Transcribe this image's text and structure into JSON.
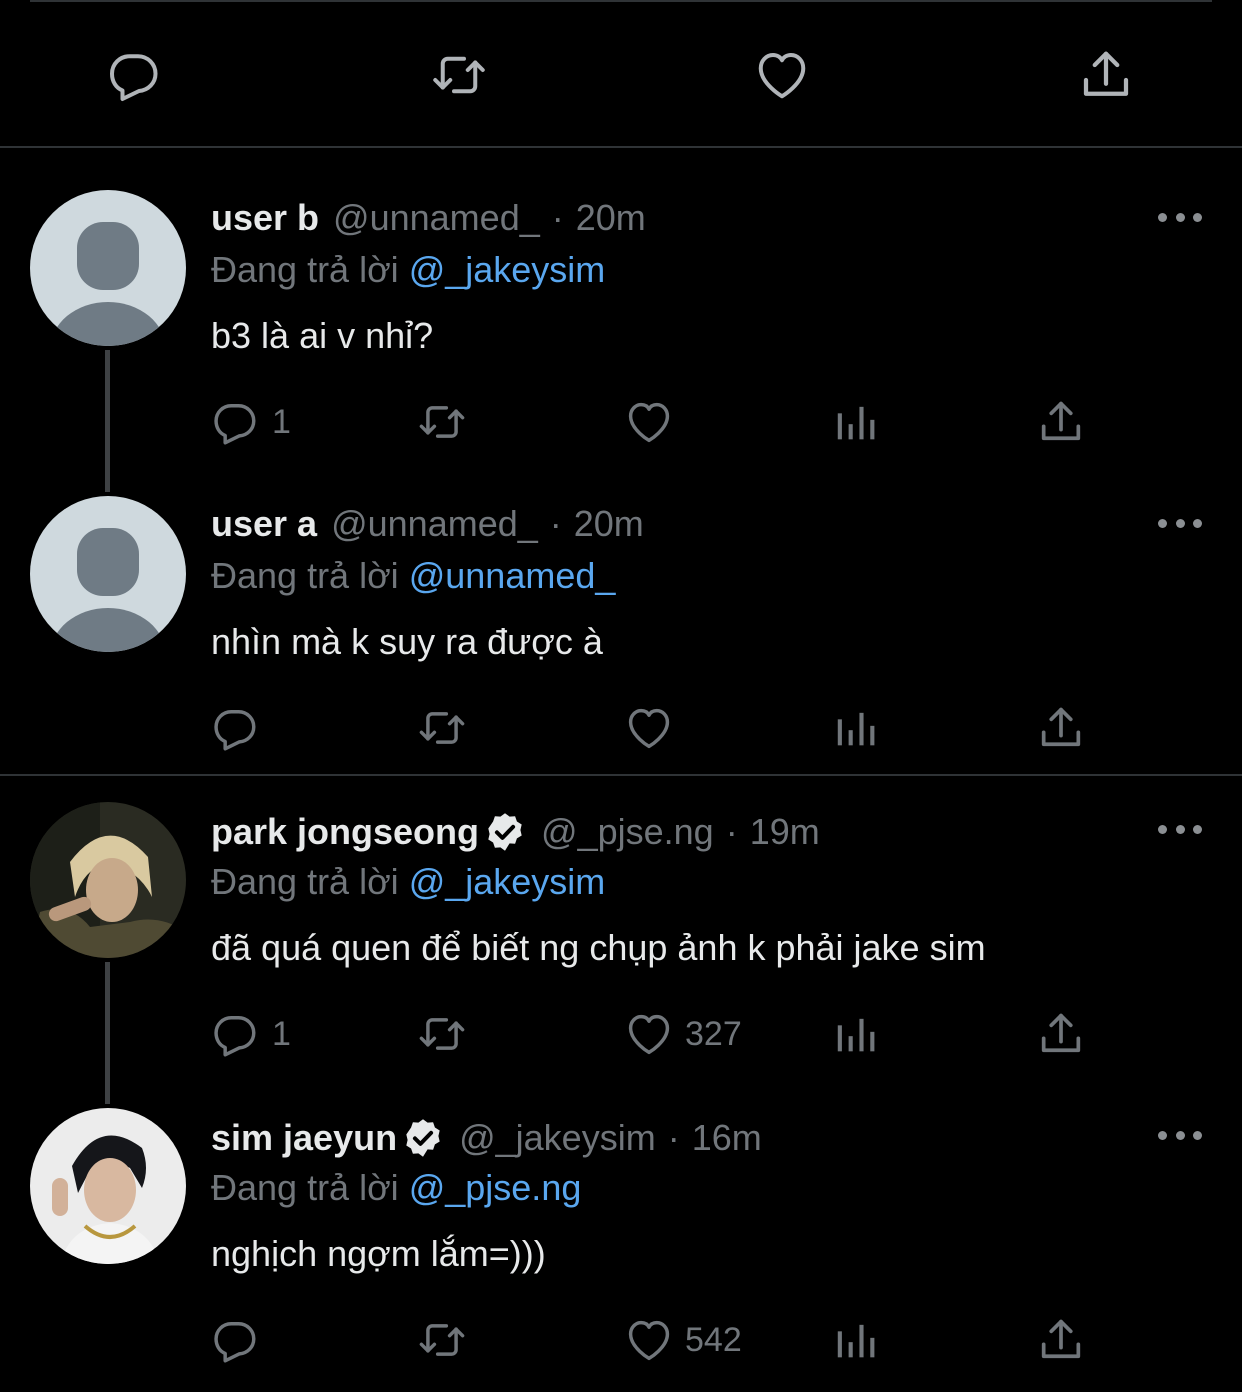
{
  "top_actions": {
    "icons": [
      "reply-icon",
      "retweet-icon",
      "like-icon",
      "share-icon"
    ]
  },
  "tweets": [
    {
      "name": "user b",
      "handle": "@unnamed_",
      "time": "20m",
      "verified": false,
      "reply_prefix": "Đang trả lời",
      "reply_to": "@_jakeysim",
      "text": "b3 là ai v nhỉ?",
      "reply_count": "1",
      "like_count": ""
    },
    {
      "name": "user a",
      "handle": "@unnamed_",
      "time": "20m",
      "verified": false,
      "reply_prefix": "Đang trả lời",
      "reply_to": "@unnamed_",
      "text": "nhìn mà k suy ra được à",
      "reply_count": "",
      "like_count": ""
    },
    {
      "name": "park jongseong",
      "handle": "@_pjse.ng",
      "time": "19m",
      "verified": true,
      "reply_prefix": "Đang trả lời",
      "reply_to": "@_jakeysim",
      "text": "đã quá quen để biết ng chụp ảnh k phải jake sim",
      "reply_count": "1",
      "like_count": "327"
    },
    {
      "name": "sim jaeyun",
      "handle": "@_jakeysim",
      "time": "16m",
      "verified": true,
      "reply_prefix": "Đang trả lời",
      "reply_to": "@_pjse.ng",
      "text": "nghịch ngợm lắm=)))",
      "reply_count": "",
      "like_count": "542"
    }
  ],
  "separator": "·",
  "colors": {
    "background": "#000000",
    "text": "#e7e9ea",
    "muted": "#71767b",
    "mention": "#5aa7ef",
    "divider": "#2f3336"
  }
}
